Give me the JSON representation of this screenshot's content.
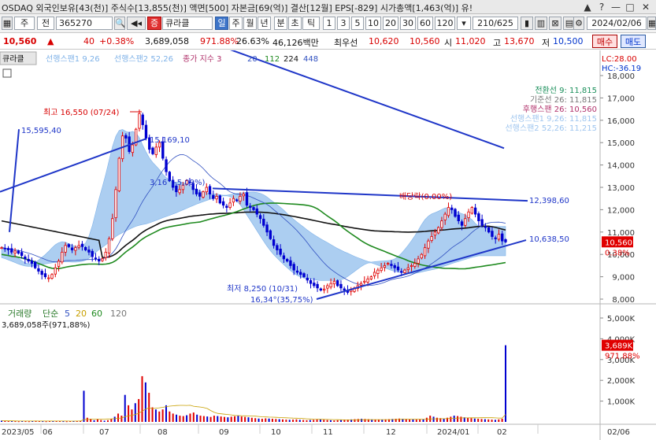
{
  "window": {
    "title": "OSDAQ 외국인보유[43(천)] 주식수[13,855(천)] 액면[500] 자본금[69(억)] 결산[12월] EPS[-829] 시가총액[1,463(억)] 유!",
    "buttons": [
      "▲",
      "?",
      "—",
      "□",
      "✕"
    ]
  },
  "toolbar": {
    "market": "주",
    "period_type": "전",
    "code": "365270",
    "stock_prefix": "증",
    "stock_name": "큐라클",
    "tabs": [
      "일",
      "주",
      "월",
      "년",
      "분",
      "초",
      "틱"
    ],
    "intervals": [
      "1",
      "3",
      "5",
      "10",
      "20",
      "30",
      "60",
      "120"
    ],
    "count": "210/625",
    "date": "2024/02/06"
  },
  "quote": {
    "price": "10,560",
    "change_arrow": "▲",
    "change": "40",
    "change_pct": "+0.38%",
    "volume": "3,689,058",
    "volume_ratio": "971.88%",
    "turnover": "26.63%",
    "amount": "46,126백만",
    "ask_label": "최우선",
    "ask": "10,620",
    "bid": "10,560",
    "open_label": "시",
    "open": "11,020",
    "high_label": "고",
    "high": "13,670",
    "low_label": "저",
    "low": "10,500",
    "buy_label": "매수",
    "sell_label": "매도"
  },
  "indicator_header": {
    "stock": "큐라클",
    "span1": "선행스팬1 9,26",
    "span2": "선행스팬2 52,26",
    "close_ma": "종가 지수 3",
    "ma_periods": [
      "20",
      "112",
      "224",
      "448"
    ]
  },
  "ichimoku_legend": [
    {
      "text": "전환선 9: 11,815",
      "color": "#1a8f5a"
    },
    {
      "text": "기준선 26: 11,815",
      "color": "#777777"
    },
    {
      "text": "후행스팬 26: 10,560",
      "color": "#b0306a"
    },
    {
      "text": "선행스팬1 9,26: 11,815",
      "color": "#9ec5ef"
    },
    {
      "text": "선행스팬2 52,26: 11,215",
      "color": "#9ec5ef"
    }
  ],
  "lc_hc": {
    "lc": "LC:28.00",
    "hc": "HC:-36.19"
  },
  "annotations": {
    "high": "최고 16,550 (07/24)",
    "low": "최저 8,250 (10/31)",
    "trend_low": "16,34°(35,75%)",
    "mid": "3,16°(-5,09%)",
    "dividend": "배당락(0.00%)",
    "lines": [
      "15,595,40",
      "15,169,10",
      "12,398,60",
      "10,638,50"
    ]
  },
  "price_badge": {
    "price": "10,560",
    "pct": "0.38%"
  },
  "volume_header": {
    "label": "거래량",
    "ma_label": "단순",
    "periods": [
      "5",
      "20",
      "60",
      "120"
    ],
    "value": "3,689,058주(971,88%)"
  },
  "volume_badge": {
    "value": "3,689K",
    "pct": "971.88%"
  },
  "colors": {
    "up": "#e00000",
    "down": "#0000d0",
    "cloud": "#9ec5ef",
    "ma_black": "#111111",
    "ma_green": "#1f8a1f",
    "trend": "#1f36c8"
  },
  "chart_data": {
    "type": "candlestick",
    "price_axis": [
      "18,000",
      "17,000",
      "16,000",
      "15,000",
      "14,000",
      "13,000",
      "12,000",
      "11,000",
      "10,000",
      "9,000",
      "8,000"
    ],
    "price_values": [
      18000,
      17000,
      16000,
      15000,
      14000,
      13000,
      12000,
      11000,
      10000,
      9000,
      8000
    ],
    "volume_axis": [
      "5,000K",
      "4,000K",
      "3,000K",
      "2,000K",
      "1,000K"
    ],
    "volume_values": [
      5000,
      4000,
      3000,
      2000,
      1000
    ],
    "dates": [
      "2023/05",
      "06",
      "07",
      "08",
      "09",
      "10",
      "11",
      "12",
      "2024/01",
      "02",
      "02/06"
    ],
    "close": [
      10300,
      10250,
      10200,
      10100,
      10150,
      10050,
      9950,
      9800,
      9700,
      9600,
      9400,
      9250,
      9100,
      9000,
      8950,
      9100,
      9400,
      9700,
      10100,
      10400,
      10350,
      10200,
      10300,
      10400,
      10350,
      10200,
      10100,
      9900,
      9800,
      9700,
      9800,
      10100,
      10700,
      11600,
      12900,
      14300,
      15300,
      15200,
      14600,
      14900,
      15600,
      16300,
      15800,
      15200,
      14700,
      14500,
      14800,
      15000,
      14300,
      13700,
      13300,
      13000,
      12800,
      12900,
      13100,
      13300,
      13200,
      12900,
      12700,
      12600,
      12800,
      13000,
      12700,
      12500,
      12600,
      12300,
      12200,
      12100,
      12300,
      12500,
      12400,
      12600,
      12700,
      12200,
      12100,
      12000,
      11800,
      11600,
      11300,
      11000,
      10700,
      10400,
      10200,
      10000,
      9800,
      9700,
      9500,
      9300,
      9200,
      9100,
      9000,
      8850,
      8700,
      8600,
      8500,
      8400,
      8450,
      8600,
      8700,
      8800,
      8600,
      8500,
      8400,
      8300,
      8400,
      8500,
      8600,
      8700,
      8800,
      8900,
      9000,
      9200,
      9300,
      9400,
      9500,
      9600,
      9500,
      9400,
      9300,
      9200,
      9300,
      9400,
      9500,
      9600,
      9800,
      10000,
      10300,
      10600,
      10800,
      11000,
      11200,
      11500,
      11800,
      12100,
      12000,
      11700,
      11500,
      11300,
      11600,
      11900,
      12100,
      11800,
      11500,
      11300,
      11200,
      11000,
      10800,
      10700,
      10900,
      10600,
      10560
    ],
    "volume_k": [
      60,
      50,
      40,
      45,
      35,
      30,
      40,
      35,
      30,
      45,
      60,
      40,
      35,
      30,
      40,
      50,
      45,
      40,
      35,
      30,
      40,
      45,
      50,
      60,
      1500,
      200,
      150,
      80,
      120,
      90,
      60,
      80,
      150,
      250,
      400,
      300,
      1300,
      800,
      600,
      900,
      1100,
      2200,
      1900,
      1400,
      700,
      600,
      500,
      600,
      800,
      500,
      400,
      350,
      300,
      280,
      320,
      400,
      450,
      350,
      300,
      280,
      260,
      240,
      300,
      280,
      260,
      240,
      220,
      250,
      270,
      300,
      260,
      240,
      220,
      200,
      180,
      160,
      150,
      170,
      160,
      150,
      140,
      130,
      120,
      110,
      100,
      110,
      120,
      100,
      90,
      80,
      90,
      100,
      110,
      120,
      100,
      90,
      80,
      70,
      80,
      90,
      100,
      110,
      120,
      130,
      140,
      150,
      140,
      130,
      120,
      110,
      100,
      110,
      120,
      130,
      140,
      150,
      160,
      150,
      140,
      130,
      120,
      110,
      120,
      130,
      200,
      300,
      250,
      200,
      180,
      160,
      200,
      250,
      300,
      280,
      250,
      220,
      200,
      180,
      160,
      150,
      140,
      130,
      120,
      110,
      100,
      120,
      150,
      3689
    ]
  }
}
